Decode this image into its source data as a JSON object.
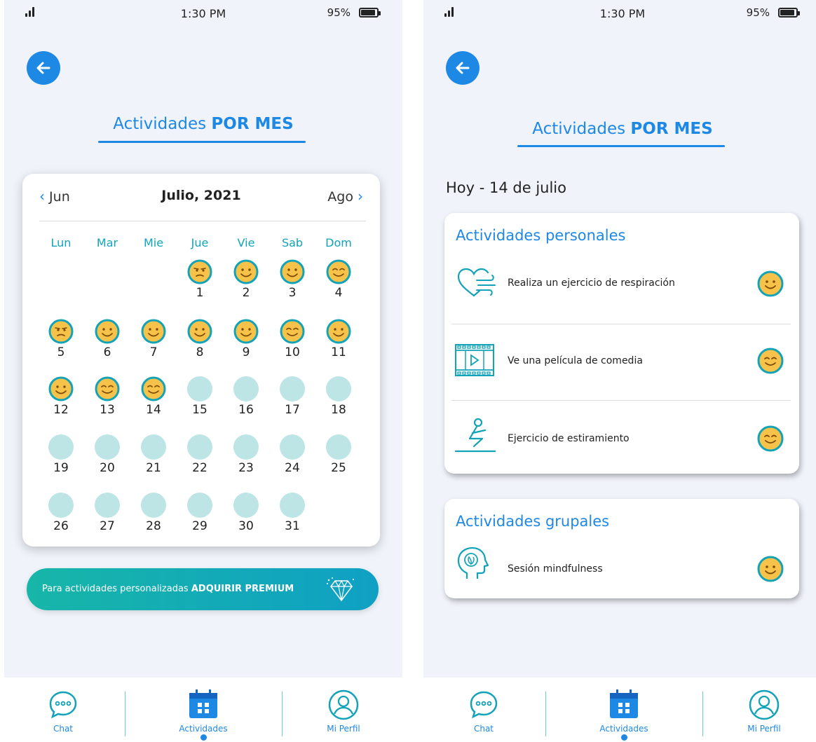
{
  "status_bar": {
    "time": "1:30 PM",
    "battery": "95%"
  },
  "header": {
    "title_regular": "Actividades ",
    "title_bold": "POR MES"
  },
  "calendar": {
    "prev_label": "Jun",
    "month_label": "Julio, 2021",
    "next_label": "Ago",
    "weekdays": [
      "Lun",
      "Mar",
      "Mie",
      "Jue",
      "Vie",
      "Sab",
      "Dom"
    ],
    "days": [
      {
        "n": "1",
        "mood": "sad"
      },
      {
        "n": "2",
        "mood": "happy"
      },
      {
        "n": "3",
        "mood": "happy"
      },
      {
        "n": "4",
        "mood": "content"
      },
      {
        "n": "5",
        "mood": "sad"
      },
      {
        "n": "6",
        "mood": "happy"
      },
      {
        "n": "7",
        "mood": "happy"
      },
      {
        "n": "8",
        "mood": "happy"
      },
      {
        "n": "9",
        "mood": "happy"
      },
      {
        "n": "10",
        "mood": "content"
      },
      {
        "n": "11",
        "mood": "happy"
      },
      {
        "n": "12",
        "mood": "happy"
      },
      {
        "n": "13",
        "mood": "content"
      },
      {
        "n": "14",
        "mood": "content"
      },
      {
        "n": "15",
        "mood": "none"
      },
      {
        "n": "16",
        "mood": "none"
      },
      {
        "n": "17",
        "mood": "none"
      },
      {
        "n": "18",
        "mood": "none"
      },
      {
        "n": "19",
        "mood": "none"
      },
      {
        "n": "20",
        "mood": "none"
      },
      {
        "n": "21",
        "mood": "none"
      },
      {
        "n": "22",
        "mood": "none"
      },
      {
        "n": "23",
        "mood": "none"
      },
      {
        "n": "24",
        "mood": "none"
      },
      {
        "n": "25",
        "mood": "none"
      },
      {
        "n": "26",
        "mood": "none"
      },
      {
        "n": "27",
        "mood": "none"
      },
      {
        "n": "28",
        "mood": "none"
      },
      {
        "n": "29",
        "mood": "none"
      },
      {
        "n": "30",
        "mood": "none"
      },
      {
        "n": "31",
        "mood": "none"
      }
    ]
  },
  "premium": {
    "text": "Para actividades personalizadas ",
    "bold": "ADQUIRIR PREMIUM",
    "icon": "diamond-icon"
  },
  "today": {
    "label": "Hoy - 14 de julio"
  },
  "personal": {
    "title": "Actividades personales",
    "items": [
      {
        "text": "Realiza un ejercicio de respiración",
        "icon": "breathing-heart-icon",
        "mood": "happy"
      },
      {
        "text": "Ve una película de comedia",
        "icon": "film-strip-icon",
        "mood": "content"
      },
      {
        "text": "Ejercicio de estiramiento",
        "icon": "stretching-icon",
        "mood": "content"
      }
    ]
  },
  "group": {
    "title": "Actividades grupales",
    "items": [
      {
        "text": "Sesión mindfulness",
        "icon": "mindfulness-head-icon",
        "mood": "happy"
      }
    ]
  },
  "nav": {
    "items": [
      {
        "label": "Chat",
        "icon": "chat-bubble-icon"
      },
      {
        "label": "Actividades",
        "icon": "calendar-icon",
        "active": true
      },
      {
        "label": "Mi Perfil",
        "icon": "user-profile-icon"
      }
    ]
  },
  "colors": {
    "accent": "#1e88e5",
    "teal": "#12a3b8",
    "empty_day": "#bde5e6",
    "face": "#f7c24a"
  }
}
